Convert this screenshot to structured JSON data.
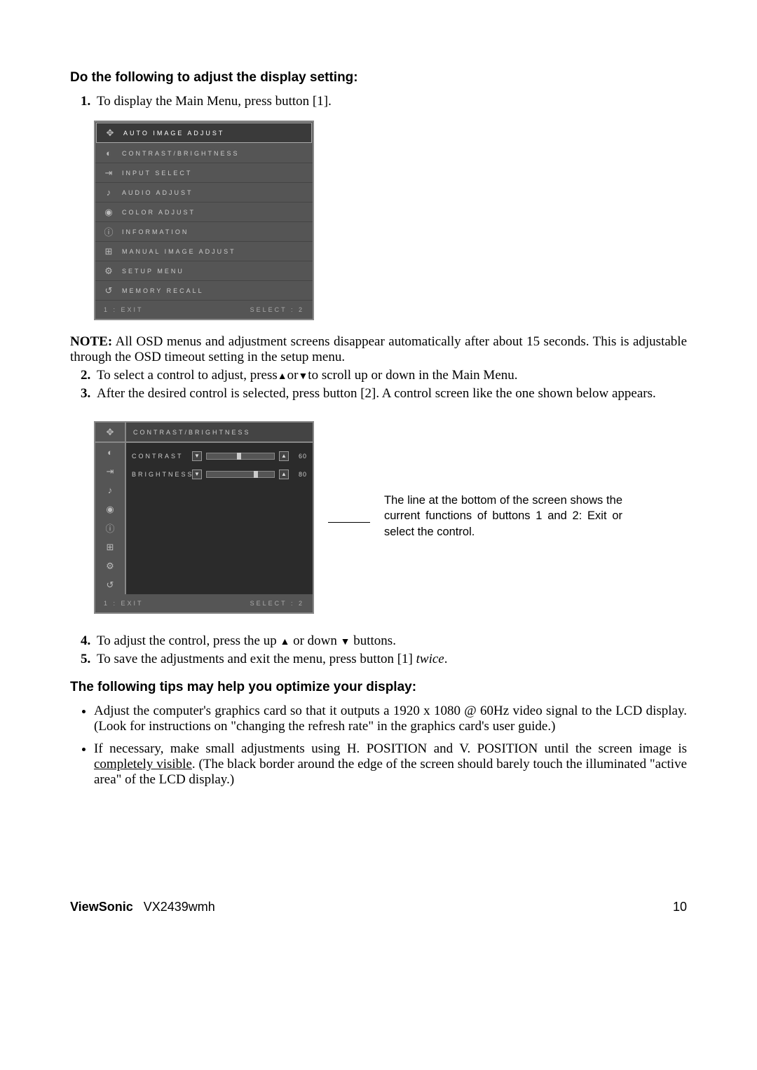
{
  "heading1": "Do the following to adjust the display setting:",
  "step1": "To display the Main Menu, press button [1].",
  "osd_menu": {
    "items": [
      {
        "icon": "✥",
        "label": "AUTO IMAGE ADJUST",
        "selected": true
      },
      {
        "icon": "◐",
        "label": "CONTRAST/BRIGHTNESS"
      },
      {
        "icon": "⇥",
        "label": "INPUT SELECT"
      },
      {
        "icon": "♪",
        "label": "AUDIO ADJUST"
      },
      {
        "icon": "◉",
        "label": "COLOR ADJUST"
      },
      {
        "icon": "ⓘ",
        "label": "INFORMATION"
      },
      {
        "icon": "⊞",
        "label": "MANUAL IMAGE ADJUST"
      },
      {
        "icon": "⚙",
        "label": "SETUP MENU"
      },
      {
        "icon": "↺",
        "label": "MEMORY RECALL"
      }
    ],
    "footer_left": "1 : EXIT",
    "footer_right": "SELECT : 2"
  },
  "note_bold": "NOTE:",
  "note_text": " All OSD menus and adjustment screens disappear automatically after about 15 seconds. This is adjustable through the OSD timeout setting in the setup menu.",
  "step2_a": "To select a control to adjust, press",
  "step2_b": "or",
  "step2_c": "to scroll up or down in the Main Menu.",
  "step3": "After the desired control is selected, press button [2]. A control screen like the one shown below appears.",
  "osd2": {
    "title": "CONTRAST/BRIGHTNESS",
    "icons": [
      "✥",
      "◐",
      "⇥",
      "♪",
      "◉",
      "ⓘ",
      "⊞",
      "⚙",
      "↺"
    ],
    "rows": [
      {
        "label": "CONTRAST",
        "value": "60",
        "pos": 45
      },
      {
        "label": "BRIGHTNESS",
        "value": "80",
        "pos": 70
      }
    ],
    "footer_left": "1 : EXIT",
    "footer_right": "SELECT : 2"
  },
  "callout": "The line at the bottom of the screen shows the current functions of buttons 1 and 2: Exit or select the control.",
  "step4_a": "To adjust the control, press the up ",
  "step4_b": " or down ",
  "step4_c": " buttons.",
  "step5_a": "To save the adjustments and exit the menu, press button [1] ",
  "step5_b": "twice",
  "step5_c": ".",
  "heading2": "The following tips may help you optimize your display:",
  "tip1": "Adjust the computer's graphics card so that it outputs a 1920 x 1080 @ 60Hz video signal to the LCD display. (Look for instructions on \"changing the refresh rate\" in the graphics card's user guide.)",
  "tip2_a": "If necessary, make small adjustments using H. POSITION and V. POSITION until the screen image is ",
  "tip2_b": "completely visible",
  "tip2_c": ". (The black border around the edge of the screen should barely touch the illuminated \"active area\" of the LCD display.)",
  "footer_brand": "ViewSonic",
  "footer_model": "VX2439wmh",
  "footer_page": "10"
}
